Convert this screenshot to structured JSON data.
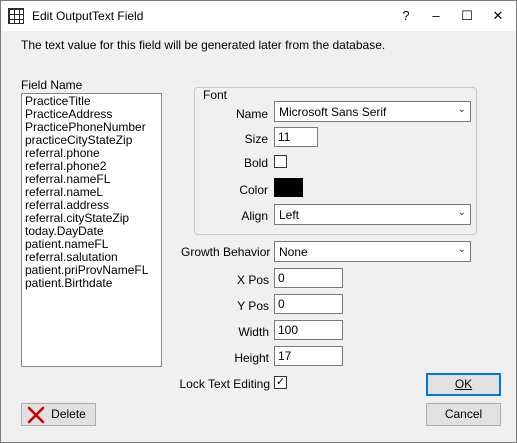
{
  "window": {
    "title": "Edit OutputText Field",
    "help_label": "?",
    "minimize_label": "–",
    "maximize_label": "☐",
    "close_label": "✕"
  },
  "info_text": "The text value for this field will be generated later from the database.",
  "field_list": {
    "label": "Field Name",
    "items": [
      "PracticeTitle",
      "PracticeAddress",
      "PracticePhoneNumber",
      "practiceCityStateZip",
      "referral.phone",
      "referral.phone2",
      "referral.nameFL",
      "referral.nameL",
      "referral.address",
      "referral.cityStateZip",
      "today.DayDate",
      "patient.nameFL",
      "referral.salutation",
      "patient.priProvNameFL",
      "patient.Birthdate"
    ]
  },
  "font_group": {
    "caption": "Font",
    "name_label": "Name",
    "name_value": "Microsoft Sans Serif",
    "size_label": "Size",
    "size_value": "11",
    "bold_label": "Bold",
    "bold_checked": false,
    "color_label": "Color",
    "color_value": "#000000",
    "align_label": "Align",
    "align_value": "Left"
  },
  "growth": {
    "label": "Growth Behavior",
    "value": "None"
  },
  "position": {
    "xpos_label": "X Pos",
    "xpos_value": "0",
    "ypos_label": "Y Pos",
    "ypos_value": "0",
    "width_label": "Width",
    "width_value": "100",
    "height_label": "Height",
    "height_value": "17"
  },
  "lock": {
    "label": "Lock Text Editing",
    "checked": true,
    "check_glyph": "✓"
  },
  "buttons": {
    "ok_label": "OK",
    "cancel_label": "Cancel",
    "delete_label": "Delete"
  }
}
